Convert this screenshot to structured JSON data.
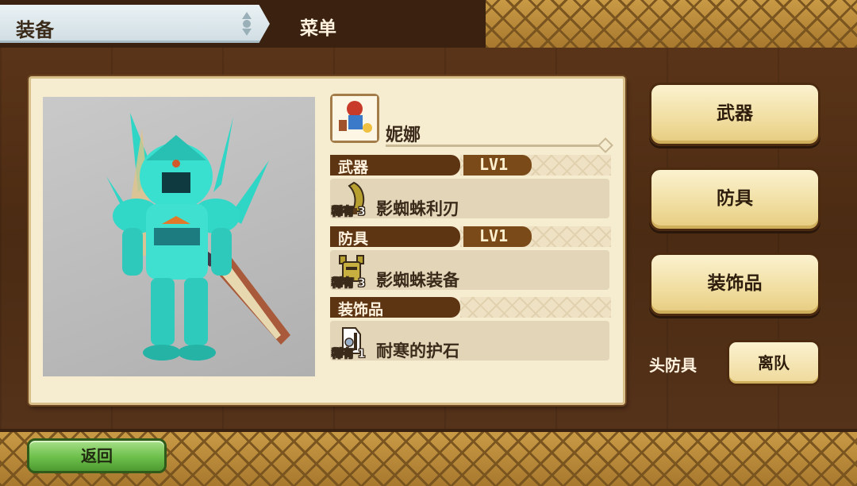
{
  "header": {
    "title": "装备",
    "menu_label": "菜单"
  },
  "character": {
    "name": "妮娜"
  },
  "sections": {
    "weapon_label": "武器",
    "weapon_level": "LV1",
    "armor_label": "防具",
    "armor_level": "LV1",
    "decoration_label": "装饰品"
  },
  "items": {
    "weapon": {
      "rarity": "稀有 3",
      "name": "影蜘蛛利刃"
    },
    "armor": {
      "rarity": "稀有 3",
      "name": "影蜘蛛装备"
    },
    "decoration": {
      "rarity": "稀有 1",
      "name": "耐寒的护石"
    }
  },
  "side_menu": {
    "weapon_button": "武器",
    "armor_button": "防具",
    "decoration_button": "装饰品",
    "head_armor_label": "头防具",
    "leave_party_button": "离队"
  },
  "footer": {
    "back_button": "返回"
  },
  "colors": {
    "wood": "#4b2b13",
    "parchment": "#f6ecd0",
    "label_bar": "#5e3512",
    "button_gold": "#f0dd9f",
    "back_green": "#6cbf4a",
    "armor_teal": "#3fe0d0"
  },
  "icons": {
    "portrait": "character-armor-model",
    "avatar": "character-avatar-icon",
    "weapon": "great-sword-icon",
    "armor": "armor-set-icon",
    "decoration": "charm-stone-icon"
  }
}
